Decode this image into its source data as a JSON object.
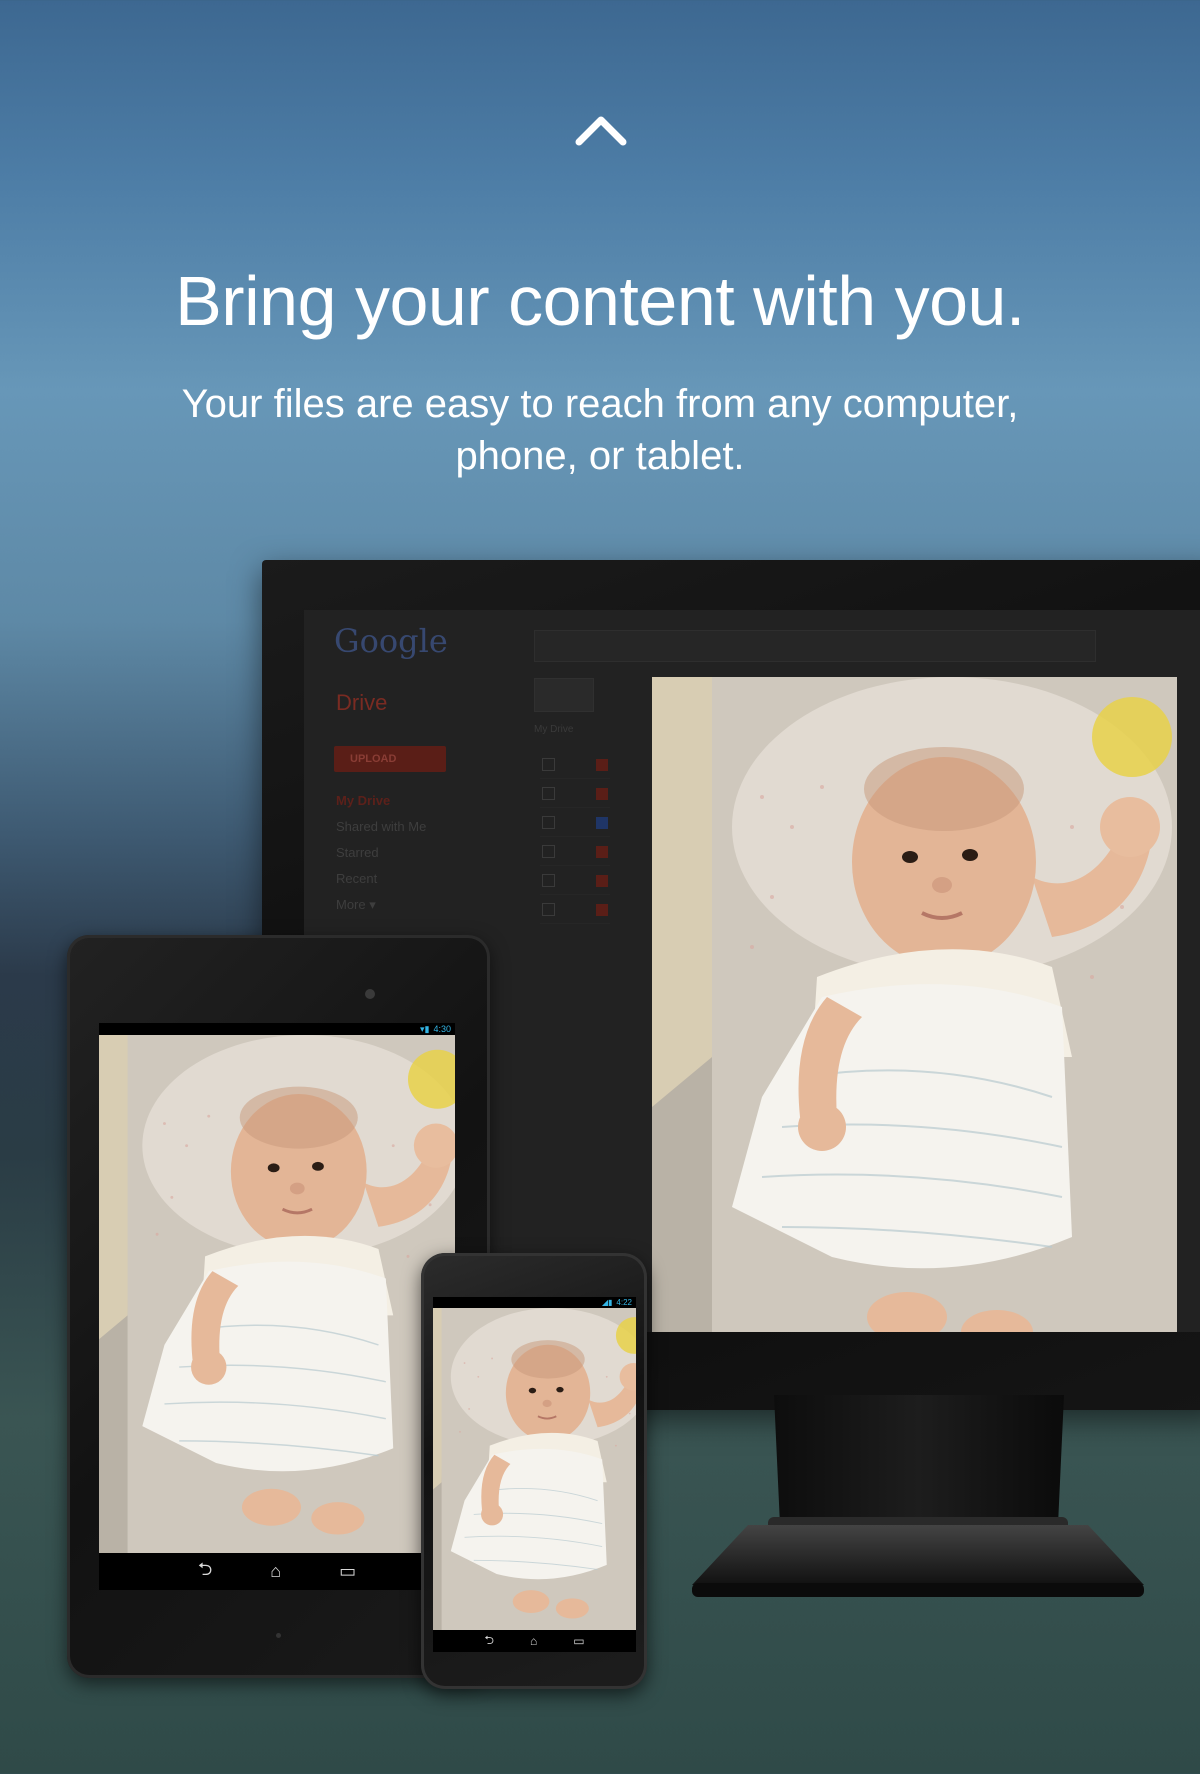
{
  "header": {
    "chevron_icon": "chevron-up-icon",
    "headline": "Bring your content with you.",
    "subtitle": "Your files are easy to reach from any computer, phone, or tablet."
  },
  "monitor": {
    "drive_ui": {
      "logo": "Google",
      "title": "Drive",
      "upload_button": "UPLOAD",
      "nav_items": [
        "My Drive",
        "Shared with Me",
        "Starred",
        "Recent",
        "More ▾"
      ],
      "breadcrumb": "My Drive"
    }
  },
  "tablet": {
    "status_time": "4:30",
    "nav_icons": [
      "back-icon",
      "home-icon",
      "recent-apps-icon"
    ]
  },
  "phone": {
    "status_time": "4:22",
    "nav_icons": [
      "back-icon",
      "home-icon",
      "recent-apps-icon"
    ]
  },
  "colors": {
    "background_top": "#3d6891",
    "background_mid": "#6797b8",
    "background_bottom": "#2f4a48",
    "android_status_blue": "#33b5e5"
  }
}
